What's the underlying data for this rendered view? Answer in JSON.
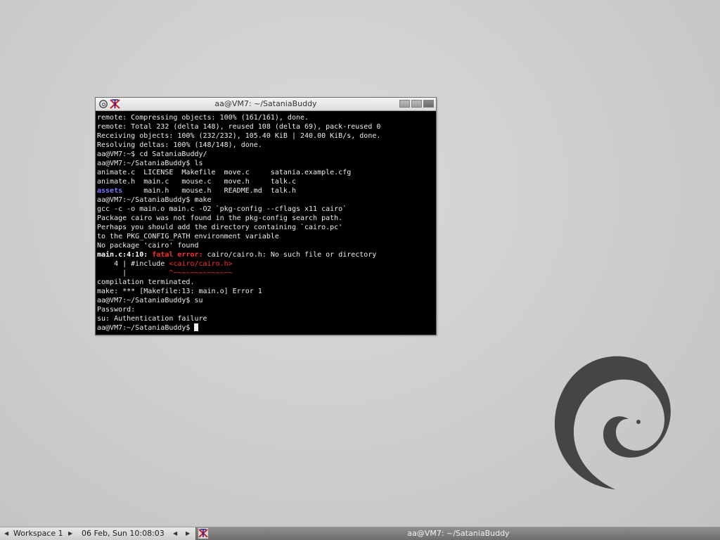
{
  "window": {
    "title": "aa@VM7: ~/SataniaBuddy"
  },
  "terminal": {
    "lines": [
      "remote: Compressing objects: 100% (161/161), done.",
      "remote: Total 232 (delta 148), reused 108 (delta 69), pack-reused 0",
      "Receiving objects: 100% (232/232), 105.40 KiB | 240.00 KiB/s, done.",
      "Resolving deltas: 100% (148/148), done.",
      "aa@VM7:~$ cd SataniaBuddy/",
      "aa@VM7:~/SataniaBuddy$ ls",
      "animate.c  LICENSE  Makefile  move.c     satania.example.cfg",
      "animate.h  main.c   mouse.c   move.h     talk.c",
      "",
      "aa@VM7:~/SataniaBuddy$ make",
      "gcc -c -o main.o main.c -O2 `pkg-config --cflags x11 cairo`",
      "Package cairo was not found in the pkg-config search path.",
      "Perhaps you should add the directory containing `cairo.pc'",
      "to the PKG_CONFIG_PATH environment variable",
      "No package 'cairo' found",
      "",
      "",
      "",
      "compilation terminated.",
      "make: *** [Makefile:13: main.o] Error 1",
      "aa@VM7:~/SataniaBuddy$ su",
      "Password:",
      "su: Authentication failure",
      "aa@VM7:~/SataniaBuddy$ "
    ],
    "ls_row3": {
      "dir": "assets",
      "rest": "     main.h   mouse.h   README.md  talk.h"
    },
    "error_line": {
      "loc": "main.c:4:10:",
      "label": "fatal error:",
      "msg": " cairo/cairo.h: No such file or directory"
    },
    "include_line": {
      "prefix": "    4 | #include ",
      "target": "<cairo/cairo.h>"
    },
    "marker_line": {
      "prefix": "      |          ",
      "marker": "^~~~~~~~~~~~~~~"
    }
  },
  "taskbar": {
    "workspace": "Workspace 1",
    "clock": "06 Feb, Sun 10:08:03",
    "app_title": "aa@VM7: ~/SataniaBuddy"
  }
}
